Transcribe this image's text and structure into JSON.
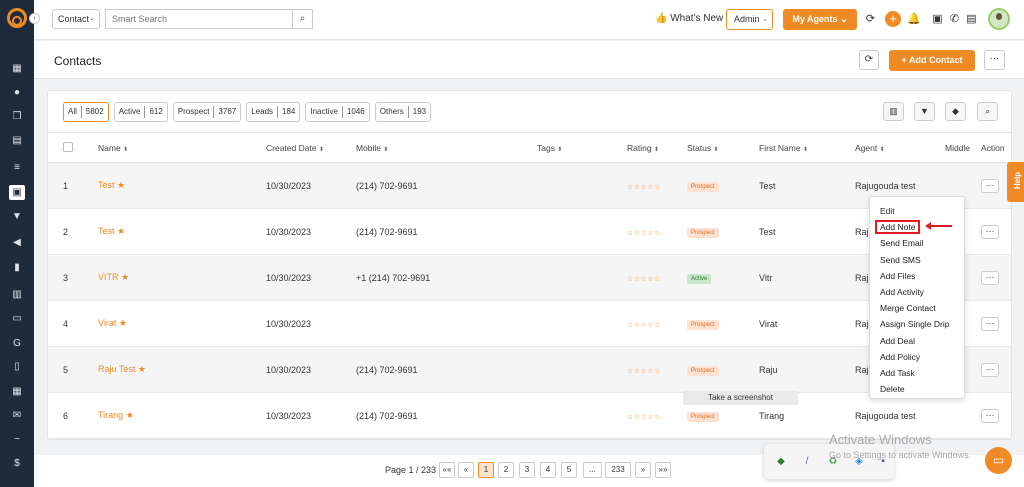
{
  "topbar": {
    "search_type": "Contact",
    "search_placeholder": "Smart Search",
    "whats_new": "What's New",
    "whats_new_emoji": "👍",
    "role": "Admin",
    "my_agents": "My Agents"
  },
  "header": {
    "title": "Contacts",
    "add_contact": "+ Add Contact"
  },
  "filters": [
    {
      "label": "All",
      "count": "5802"
    },
    {
      "label": "Active",
      "count": "612"
    },
    {
      "label": "Prospect",
      "count": "3767"
    },
    {
      "label": "Leads",
      "count": "184"
    },
    {
      "label": "Inactive",
      "count": "1046"
    },
    {
      "label": "Others",
      "count": "193"
    }
  ],
  "columns": {
    "name": "Name",
    "created_date": "Created Date",
    "mobile": "Mobile",
    "tags": "Tags",
    "rating": "Rating",
    "status": "Status",
    "first_name": "First Name",
    "agent": "Agent",
    "middle": "Middle",
    "action": "Action"
  },
  "rows": [
    {
      "num": "1",
      "name": "Test",
      "created": "10/30/2023",
      "mobile": "(214) 702-9691",
      "rating": "☆☆☆☆☆",
      "status": "Prospect",
      "first_name": "Test",
      "agent": "Rajugouda test"
    },
    {
      "num": "2",
      "name": "Test",
      "created": "10/30/2023",
      "mobile": "(214) 702-9691",
      "rating": "☆☆☆☆☆",
      "status": "Prospect",
      "first_name": "Test",
      "agent": "Raj"
    },
    {
      "num": "3",
      "name": "VITR",
      "created": "10/30/2023",
      "mobile": "+1 (214) 702-9691",
      "rating": "☆☆☆☆☆",
      "status": "Active",
      "first_name": "Vitr",
      "agent": "Raj"
    },
    {
      "num": "4",
      "name": "Virat",
      "created": "10/30/2023",
      "mobile": "",
      "rating": "☆☆☆☆☆",
      "status": "Prospect",
      "first_name": "Virat",
      "agent": "Raj"
    },
    {
      "num": "5",
      "name": "Raju Test",
      "created": "10/30/2023",
      "mobile": "(214) 702-9691",
      "rating": "☆☆☆☆☆",
      "status": "Prospect",
      "first_name": "Raju",
      "agent": "Raj"
    },
    {
      "num": "6",
      "name": "Tirang",
      "created": "10/30/2023",
      "mobile": "(214) 702-9691",
      "rating": "☆☆☆☆☆",
      "status": "Prospect",
      "first_name": "Tirang",
      "agent": "Rajugouda test"
    }
  ],
  "action_menu": [
    "Edit",
    "Add Note",
    "Send Email",
    "Send SMS",
    "Add Files",
    "Add Activity",
    "Merge Contact",
    "Assign Single Drip",
    "Add Deal",
    "Add Policy",
    "Add Task",
    "Delete"
  ],
  "tooltip": "Take a screenshot",
  "help": "Help",
  "pagination": {
    "info": "Page 1 / 233",
    "first": "««",
    "prev": "«",
    "pages": [
      "1",
      "2",
      "3",
      "4",
      "5",
      "...",
      "233"
    ],
    "next": "»",
    "last": "»»"
  },
  "watermark": {
    "line1": "Activate Windows",
    "line2": "Go to Settings to activate Windows."
  },
  "colors": {
    "accent": "#f08a24",
    "sidebar": "#1f2a3a",
    "highlight": "#e31b23"
  }
}
